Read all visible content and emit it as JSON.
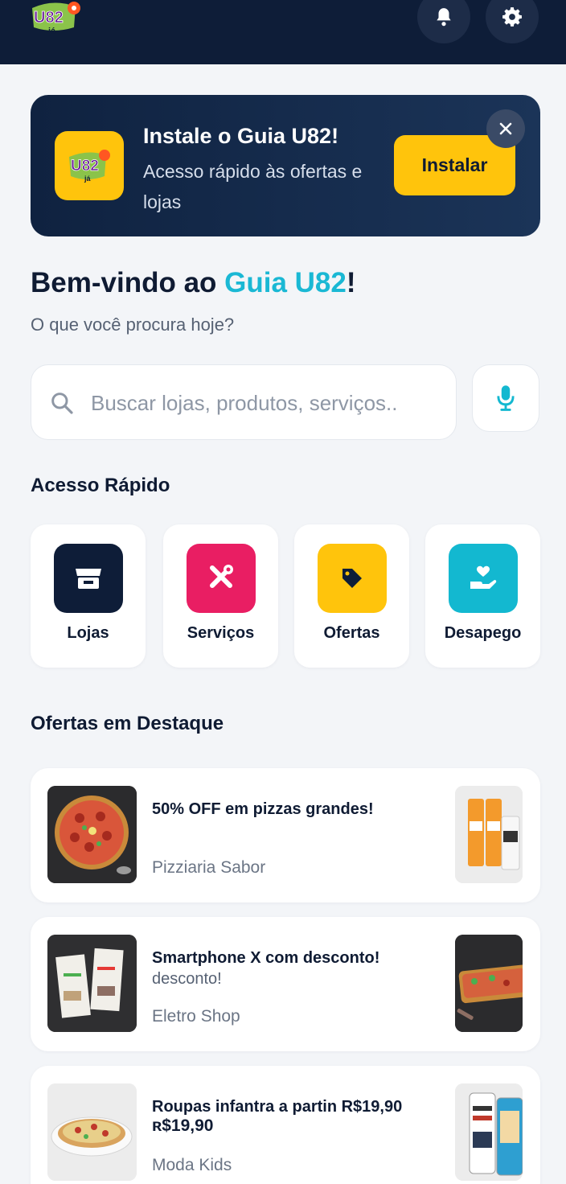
{
  "header": {
    "logo_text": "U82",
    "logo_sub": "já",
    "bell_icon": "bell-icon",
    "gear_icon": "gear-icon"
  },
  "install_banner": {
    "title": "Instale o Guia U82!",
    "description": "Acesso rápido às ofertas e lojas",
    "button_label": "Instalar",
    "close_icon": "close-icon"
  },
  "welcome": {
    "prefix": "Bem-vindo ao ",
    "brand": "Guia U82",
    "suffix": "!",
    "subtitle": "O que você procura hoje?"
  },
  "search": {
    "placeholder": "Buscar lojas, produtos, serviços..",
    "value": "",
    "mic_icon": "microphone-icon"
  },
  "quick_access": {
    "title": "Acesso Rápido",
    "items": [
      {
        "label": "Lojas",
        "icon": "store-icon",
        "color": "#0e1d38"
      },
      {
        "label": "Serviços",
        "icon": "tools-icon",
        "color": "#e91e63"
      },
      {
        "label": "Ofertas",
        "icon": "tag-icon",
        "color": "#ffc40c"
      },
      {
        "label": "Desapego",
        "icon": "hand-heart-icon",
        "color": "#13b8d0"
      }
    ]
  },
  "featured": {
    "title": "Ofertas em Destaque",
    "offers": [
      {
        "title": "50% OFF em pizzas grandes!",
        "extra": "",
        "store": "Pizziaria Sabor"
      },
      {
        "title": "Smartphone X com desconto!",
        "extra": "desconto!",
        "store": "Eletro Shop"
      },
      {
        "title": "Roupas infantra a partin R$19,90",
        "extra": "ʀ$19,90",
        "store": "Moda Kids"
      }
    ]
  },
  "colors": {
    "navy": "#0e1d38",
    "accent_cyan": "#1ab8d4",
    "yellow": "#ffc40c",
    "pink": "#e91e63"
  }
}
